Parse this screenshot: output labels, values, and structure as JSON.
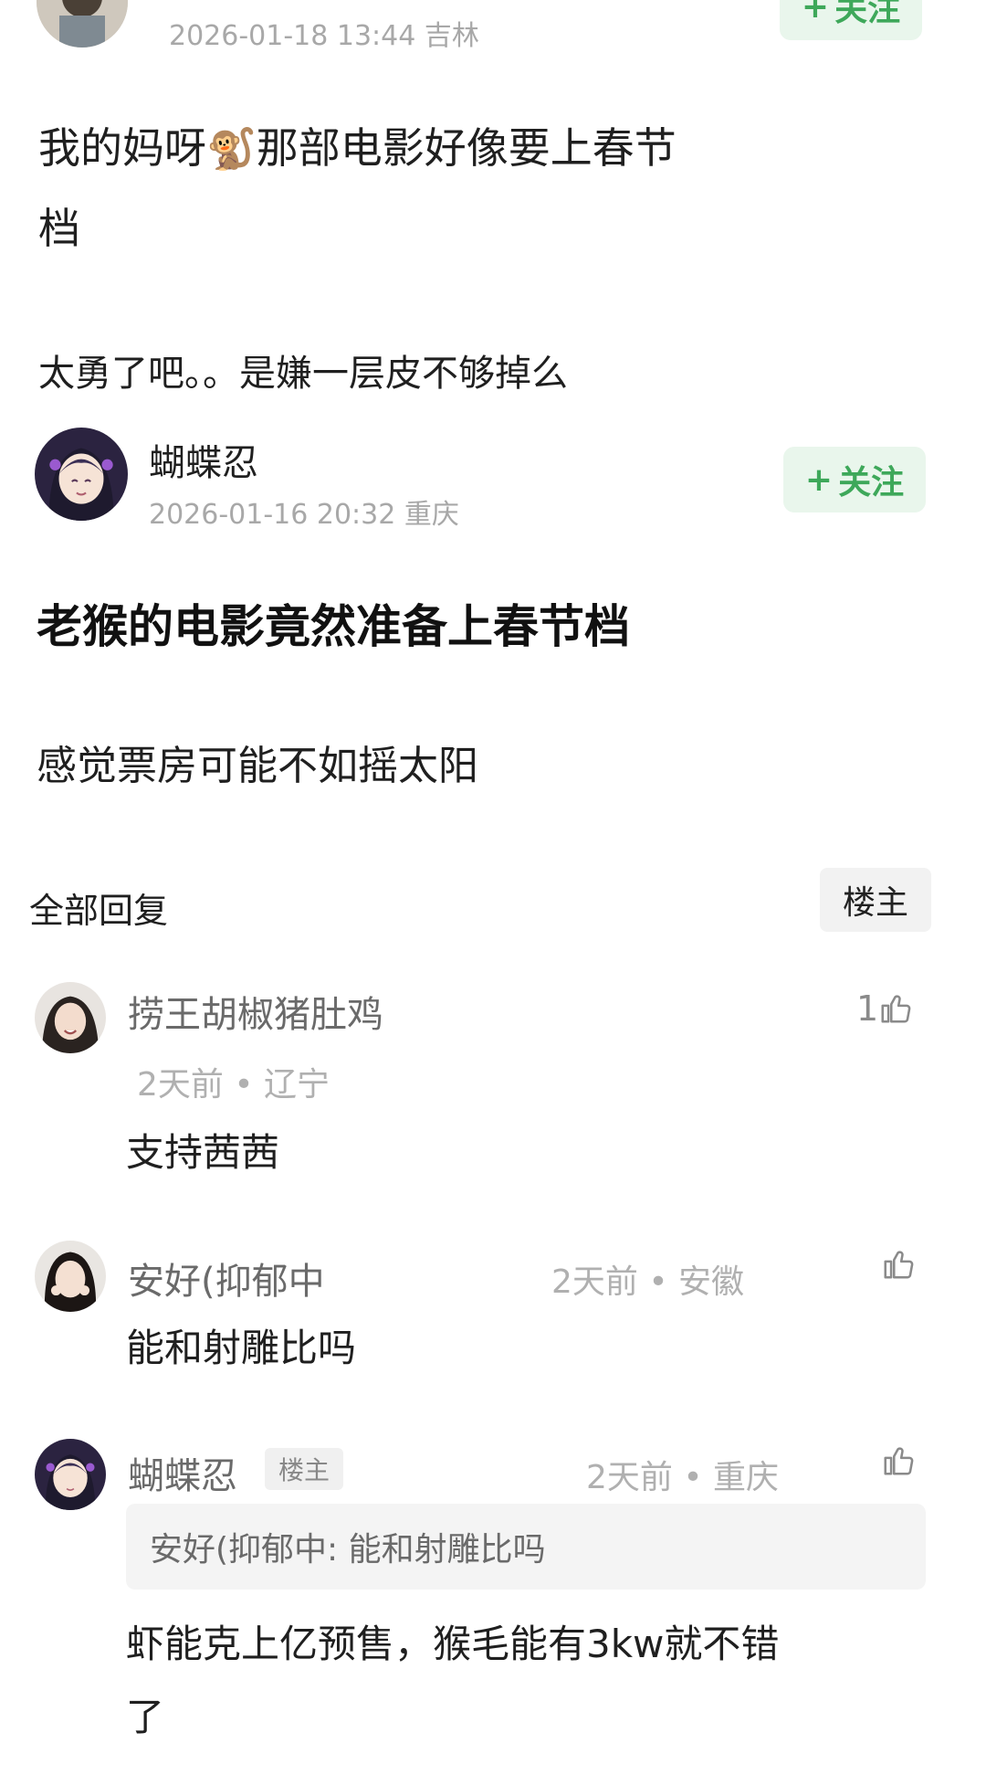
{
  "post1": {
    "meta": "2026-01-18 13:44  吉林",
    "follow": "关注",
    "body_pre": "我的妈呀",
    "emoji": "🐒",
    "body_post": "那部电影好像要上春节",
    "body_line2": "档",
    "body_extra": "太勇了吧。。是嫌一层皮不够掉么"
  },
  "post2": {
    "username": "蝴蝶忍",
    "meta": "2026-01-16 20:32  重庆",
    "follow": "关注",
    "title": "老猴的电影竟然准备上春节档",
    "body": "感觉票房可能不如摇太阳"
  },
  "replies_header": {
    "title": "全部回复",
    "filter": "楼主"
  },
  "replies": [
    {
      "name": "捞王胡椒猪肚鸡",
      "meta": "2天前 • 辽宁",
      "likes": "1",
      "text": "支持茜茜"
    },
    {
      "name": "安好(抑郁中",
      "meta": "2天前 • 安徽",
      "likes": "",
      "text": "能和射雕比吗"
    },
    {
      "name": "蝴蝶忍",
      "tag": "楼主",
      "meta": "2天前 • 重庆",
      "likes": "",
      "quote": "安好(抑郁中: 能和射雕比吗",
      "text_line1": "虾能克上亿预售，猴毛能有3kw就不错",
      "text_line2": "了"
    }
  ],
  "colors": {
    "follow_bg": "#e9f6ec",
    "follow_text": "#3ea85a",
    "meta_text": "#a8a8a8"
  },
  "icons": [
    "plus-icon",
    "thumbs-up-icon",
    "monkey-emoji"
  ]
}
